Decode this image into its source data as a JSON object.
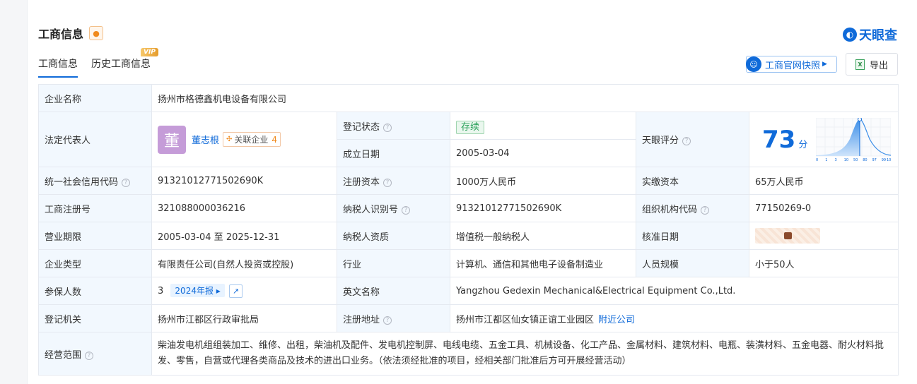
{
  "header": {
    "title": "工商信息",
    "brand": "天眼查"
  },
  "tabs": [
    {
      "label": "工商信息"
    },
    {
      "label": "历史工商信息"
    }
  ],
  "vip_badge": "VIP",
  "actions": {
    "snapshot_label": "工商官网快照",
    "export_label": "导出"
  },
  "rows": {
    "company_name": {
      "key": "企业名称",
      "value": "扬州市格德鑫机电设备有限公司"
    },
    "legal_rep": {
      "key": "法定代表人",
      "avatar_char": "董",
      "name": "董志根",
      "assoc_label": "关联企业",
      "assoc_count": "4"
    },
    "reg_status": {
      "key": "登记状态",
      "value": "存续"
    },
    "found_date": {
      "key": "成立日期",
      "value": "2005-03-04"
    },
    "score": {
      "key": "天眼评分",
      "value": "73",
      "unit": "分",
      "ticks": [
        "0",
        "1",
        "3",
        "10",
        "50",
        "80",
        "97",
        "99",
        "100"
      ]
    },
    "credit_code": {
      "key": "统一社会信用代码",
      "value": "91321012771502690K"
    },
    "reg_capital": {
      "key": "注册资本",
      "value": "1000万人民币"
    },
    "paid_capital": {
      "key": "实缴资本",
      "value": "65万人民币"
    },
    "reg_no": {
      "key": "工商注册号",
      "value": "321088000036216"
    },
    "taxpayer_id": {
      "key": "纳税人识别号",
      "value": "91321012771502690K"
    },
    "org_code": {
      "key": "组织机构代码",
      "value": "77150269-0"
    },
    "term": {
      "key": "营业期限",
      "value": "2005-03-04 至 2025-12-31"
    },
    "tax_qual": {
      "key": "纳税人资质",
      "value": "增值税一般纳税人"
    },
    "approve_date": {
      "key": "核准日期"
    },
    "company_type": {
      "key": "企业类型",
      "value": "有限责任公司(自然人投资或控股)"
    },
    "industry": {
      "key": "行业",
      "value": "计算机、通信和其他电子设备制造业"
    },
    "staff_size": {
      "key": "人员规模",
      "value": "小于50人"
    },
    "insured": {
      "key": "参保人数",
      "value": "3",
      "report": "2024年报"
    },
    "english_name": {
      "key": "英文名称",
      "value": "Yangzhou Gedexin Mechanical&Electrical Equipment Co.,Ltd."
    },
    "authority": {
      "key": "登记机关",
      "value": "扬州市江都区行政审批局"
    },
    "address": {
      "key": "注册地址",
      "value": "扬州市江都区仙女镇正谊工业园区",
      "nearby": "附近公司"
    },
    "scope": {
      "key": "经营范围",
      "value": "柴油发电机组组装加工、维修、出租，柴油机及配件、发电机控制屏、电线电缆、五金工具、机械设备、化工产品、金属材料、建筑材料、电瓶、装潢材料、五金电器、耐火材料批发、零售，自营或代理各类商品及技术的进出口业务。（依法须经批准的项目，经相关部门批准后方可开展经营活动）"
    }
  },
  "colors": {
    "accent": "#0f6ad9",
    "key_bg": "#f2f8fe",
    "status_green": "#2aa15a"
  }
}
